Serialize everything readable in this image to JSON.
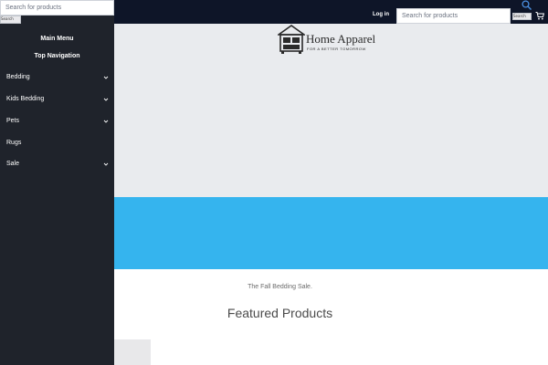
{
  "header": {
    "login_label": "Log in",
    "search": {
      "placeholder": "Search for products",
      "button_label": "Search"
    }
  },
  "drawer": {
    "search": {
      "placeholder": "Search for products",
      "button_label": "Search"
    },
    "headings": [
      "Main Menu",
      "Top Navigation"
    ],
    "items": [
      {
        "label": "Bedding",
        "has_submenu": true
      },
      {
        "label": "Kids Bedding",
        "has_submenu": true
      },
      {
        "label": "Pets",
        "has_submenu": true
      },
      {
        "label": "Rugs",
        "has_submenu": false
      },
      {
        "label": "Sale",
        "has_submenu": true
      }
    ]
  },
  "logo": {
    "title": "Home Apparel",
    "subtitle": "FOR A BETTER TOMORROW"
  },
  "main": {
    "tagline": "The Fall Bedding Sale.",
    "featured_heading": "Featured Products"
  },
  "colors": {
    "header_bg": "#0e1528",
    "drawer_bg": "#1f232b",
    "hero_bg": "#e9ebee",
    "banner": "#35b4ee",
    "search_icon": "#4a8fe0"
  },
  "icons": {
    "search": "search-icon",
    "cart": "cart-icon",
    "chevron": "chevron-down-icon"
  }
}
